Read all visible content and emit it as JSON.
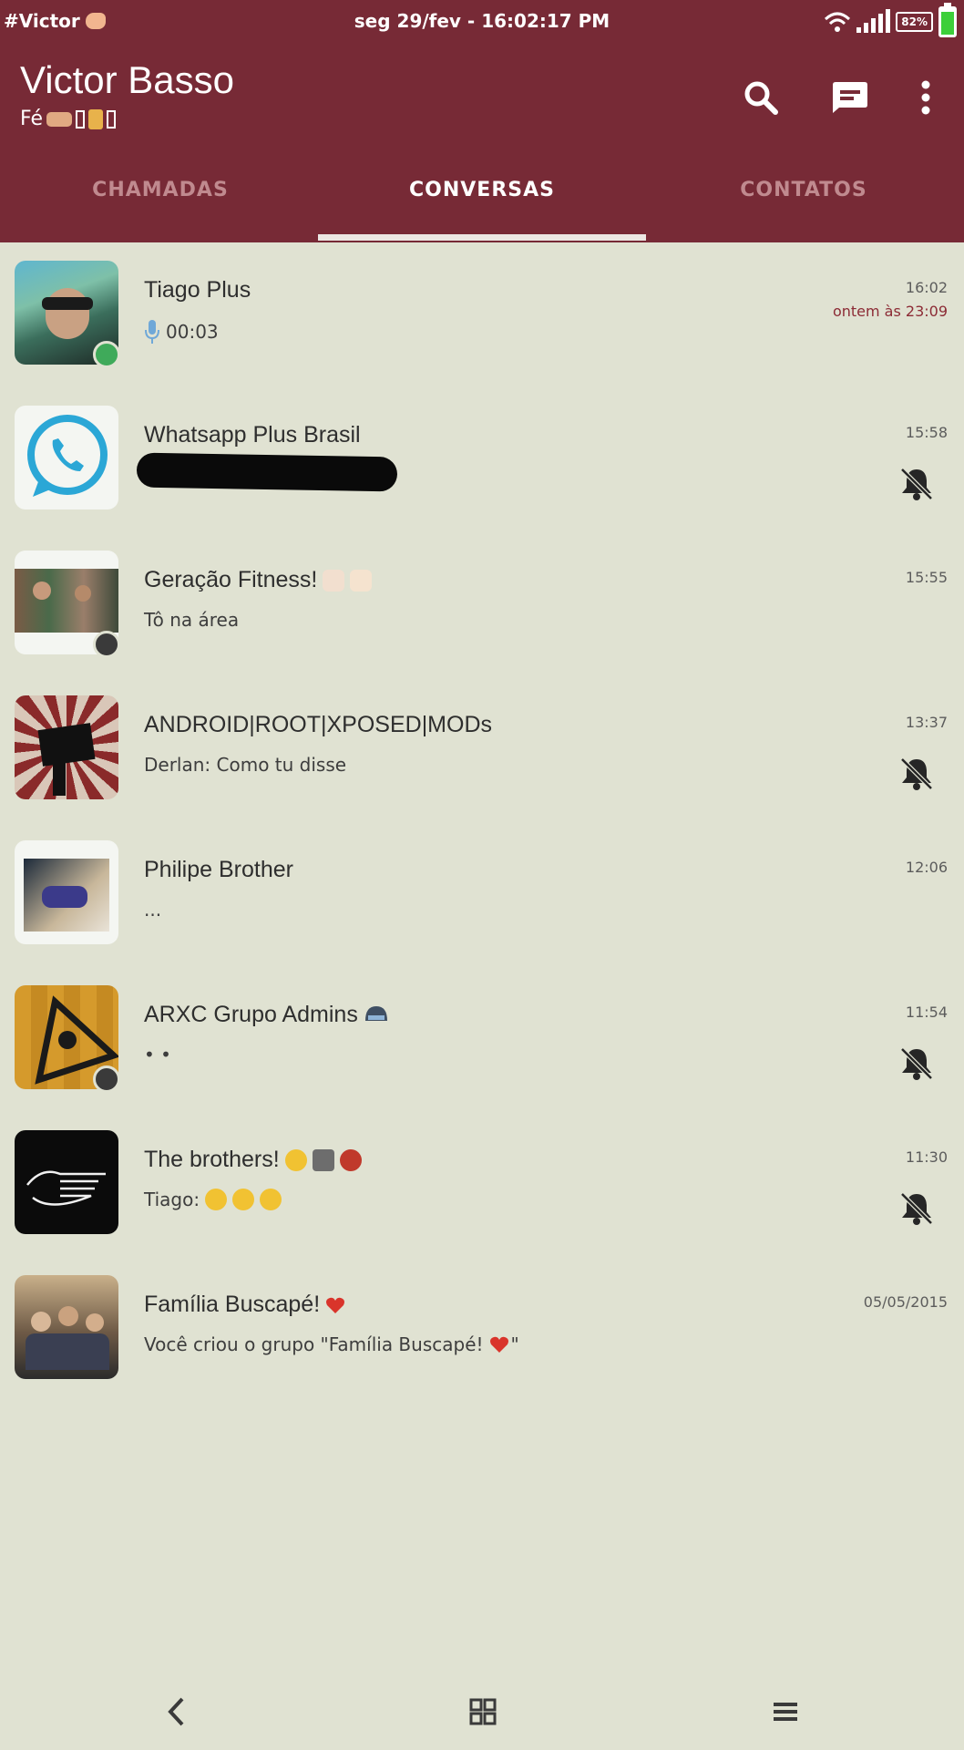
{
  "status_bar": {
    "carrier": "#Victor",
    "datetime": "seg 29/fev - 16:02:17 PM",
    "battery": "82%"
  },
  "profile": {
    "name": "Victor Basso",
    "status": "Fé"
  },
  "tabs": [
    {
      "label": "CHAMADAS",
      "active": false
    },
    {
      "label": "CONVERSAS",
      "active": true
    },
    {
      "label": "CONTATOS",
      "active": false
    }
  ],
  "chats": [
    {
      "name": "Tiago Plus",
      "preview": "00:03",
      "time": "16:02",
      "sub_time": "ontem às 23:09",
      "muted": false
    },
    {
      "name": "Whatsapp Plus Brasil",
      "preview": "",
      "time": "15:58",
      "muted": true
    },
    {
      "name": "Geração Fitness!",
      "preview": "Tô na área",
      "time": "15:55",
      "muted": false
    },
    {
      "name": "ANDROID|ROOT|XPOSED|MODs",
      "preview": "Derlan: Como tu disse",
      "time": "13:37",
      "muted": true
    },
    {
      "name": "Philipe Brother",
      "preview": "...",
      "time": "12:06",
      "muted": false
    },
    {
      "name": "ARXC Grupo Admins",
      "preview": "• •",
      "time": "11:54",
      "muted": true
    },
    {
      "name": "The brothers!",
      "preview": "Tiago:",
      "time": "11:30",
      "muted": true
    },
    {
      "name": "Família Buscapé!",
      "preview": "Você criou o grupo \"Família Buscapé!",
      "preview_end": "\"",
      "time": "05/05/2015",
      "muted": false
    }
  ],
  "colors": {
    "header": "#772a36",
    "background": "#e0e2d2",
    "tab_inactive": "#c08a8f",
    "accent_time": "#8c2b35"
  },
  "icons": {
    "search": "search-icon",
    "new_chat": "new-chat-icon",
    "menu": "overflow-menu-icon",
    "muted": "bell-off-icon",
    "nav_back": "back-icon",
    "nav_home": "home-grid-icon",
    "nav_menu": "menu-lines-icon"
  }
}
